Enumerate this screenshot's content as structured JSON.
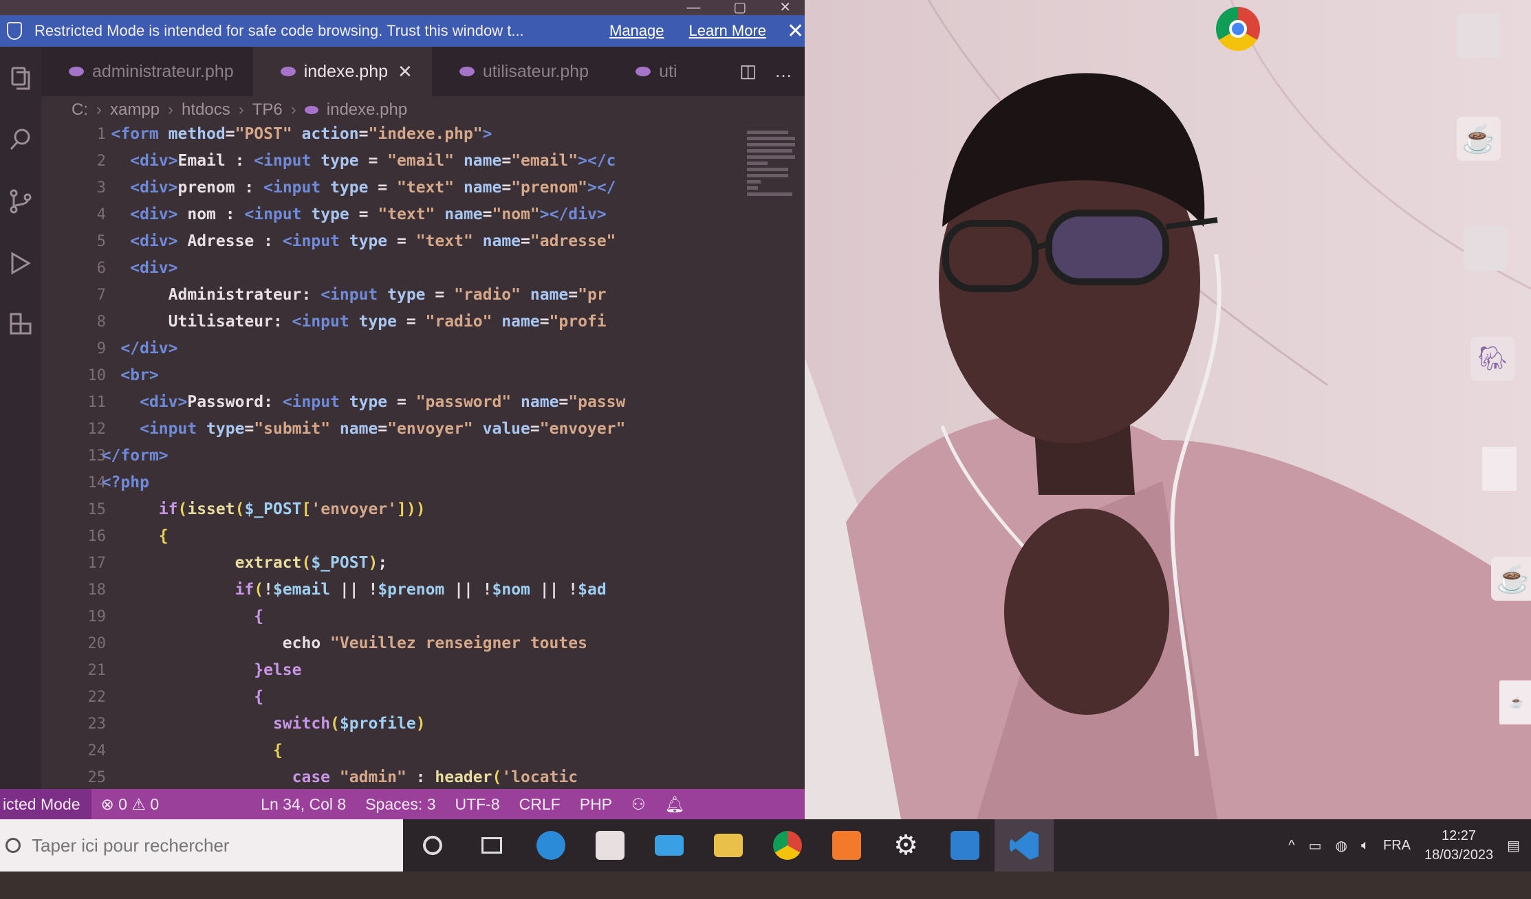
{
  "window": {
    "controls": [
      "—",
      "▢",
      "✕"
    ]
  },
  "banner": {
    "message": "Restricted Mode is intended for safe code browsing. Trust this window t...",
    "manage": "Manage",
    "learn_more": "Learn More",
    "close": "✕"
  },
  "tabs": [
    {
      "label": "administrateur.php",
      "active": false
    },
    {
      "label": "indexe.php",
      "active": true
    },
    {
      "label": "utilisateur.php",
      "active": false
    },
    {
      "label": "uti",
      "active": false
    }
  ],
  "tab_tools": {
    "split": "◫",
    "more": "…"
  },
  "breadcrumb": [
    "C:",
    "xampp",
    "htdocs",
    "TP6",
    "indexe.php"
  ],
  "editor": {
    "line_numbers": [
      "1",
      "2",
      "3",
      "4",
      "5",
      "6",
      "7",
      "8",
      "9",
      "10",
      "11",
      "12",
      "13",
      "14",
      "15",
      "16",
      "17",
      "18",
      "19",
      "20",
      "21",
      "22",
      "23",
      "24",
      "25"
    ]
  },
  "code": [
    {
      "i": "   ",
      "parts": [
        [
          "tag",
          "<form "
        ],
        [
          "attr",
          "method"
        ],
        [
          "txt",
          "="
        ],
        [
          "str",
          "\"POST\" "
        ],
        [
          "attr",
          "action"
        ],
        [
          "txt",
          "="
        ],
        [
          "str",
          "\"indexe.php\""
        ],
        [
          "tag",
          ">"
        ]
      ]
    },
    {
      "i": "     ",
      "parts": [
        [
          "tag",
          "<div>"
        ],
        [
          "txt",
          "Email : "
        ],
        [
          "tag",
          "<input "
        ],
        [
          "attr",
          "type"
        ],
        [
          "txt",
          " = "
        ],
        [
          "str",
          "\"email\" "
        ],
        [
          "attr",
          "name"
        ],
        [
          "txt",
          "="
        ],
        [
          "str",
          "\"email\""
        ],
        [
          "tag",
          "></c"
        ]
      ]
    },
    {
      "i": "     ",
      "parts": [
        [
          "tag",
          "<div>"
        ],
        [
          "txt",
          "prenom : "
        ],
        [
          "tag",
          "<input "
        ],
        [
          "attr",
          "type"
        ],
        [
          "txt",
          " = "
        ],
        [
          "str",
          "\"text\" "
        ],
        [
          "attr",
          "name"
        ],
        [
          "txt",
          "="
        ],
        [
          "str",
          "\"prenom\""
        ],
        [
          "tag",
          "></"
        ]
      ]
    },
    {
      "i": "     ",
      "parts": [
        [
          "tag",
          "<div> "
        ],
        [
          "txt",
          "nom : "
        ],
        [
          "tag",
          "<input "
        ],
        [
          "attr",
          "type"
        ],
        [
          "txt",
          " = "
        ],
        [
          "str",
          "\"text\" "
        ],
        [
          "attr",
          "name"
        ],
        [
          "txt",
          "="
        ],
        [
          "str",
          "\"nom\""
        ],
        [
          "tag",
          "></div>"
        ]
      ]
    },
    {
      "i": "     ",
      "parts": [
        [
          "tag",
          "<div> "
        ],
        [
          "txt",
          "Adresse : "
        ],
        [
          "tag",
          "<input "
        ],
        [
          "attr",
          "type"
        ],
        [
          "txt",
          " = "
        ],
        [
          "str",
          "\"text\" "
        ],
        [
          "attr",
          "name"
        ],
        [
          "txt",
          "="
        ],
        [
          "str",
          "\"adresse\""
        ]
      ]
    },
    {
      "i": "     ",
      "parts": [
        [
          "tag",
          "<div>"
        ]
      ]
    },
    {
      "i": "         ",
      "parts": [
        [
          "txt",
          "Administrateur: "
        ],
        [
          "tag",
          "<input "
        ],
        [
          "attr",
          "type"
        ],
        [
          "txt",
          " = "
        ],
        [
          "str",
          "\"radio\" "
        ],
        [
          "attr",
          "name"
        ],
        [
          "txt",
          "="
        ],
        [
          "str",
          "\"pr"
        ]
      ]
    },
    {
      "i": "         ",
      "parts": [
        [
          "txt",
          "Utilisateur: "
        ],
        [
          "tag",
          "<input "
        ],
        [
          "attr",
          "type"
        ],
        [
          "txt",
          " = "
        ],
        [
          "str",
          "\"radio\" "
        ],
        [
          "attr",
          "name"
        ],
        [
          "txt",
          "="
        ],
        [
          "str",
          "\"profi"
        ]
      ]
    },
    {
      "i": "    ",
      "parts": [
        [
          "tag",
          "</div>"
        ]
      ]
    },
    {
      "i": "    ",
      "parts": [
        [
          "tag",
          "<br>"
        ]
      ]
    },
    {
      "i": "      ",
      "parts": [
        [
          "tag",
          "<div>"
        ],
        [
          "txt",
          "Password: "
        ],
        [
          "tag",
          "<input "
        ],
        [
          "attr",
          "type"
        ],
        [
          "txt",
          " = "
        ],
        [
          "str",
          "\"password\" "
        ],
        [
          "attr",
          "name"
        ],
        [
          "txt",
          "="
        ],
        [
          "str",
          "\"passw"
        ]
      ]
    },
    {
      "i": "      ",
      "parts": [
        [
          "tag",
          "<input "
        ],
        [
          "attr",
          "type"
        ],
        [
          "txt",
          "="
        ],
        [
          "str",
          "\"submit\" "
        ],
        [
          "attr",
          "name"
        ],
        [
          "txt",
          "="
        ],
        [
          "str",
          "\"envoyer\" "
        ],
        [
          "attr",
          "value"
        ],
        [
          "txt",
          "="
        ],
        [
          "str",
          "\"envoyer\""
        ]
      ]
    },
    {
      "i": "  ",
      "parts": [
        [
          "tag",
          "</form>"
        ]
      ]
    },
    {
      "i": "  ",
      "parts": [
        [
          "tag",
          "<?php"
        ]
      ]
    },
    {
      "i": "        ",
      "parts": [
        [
          "kw",
          "if"
        ],
        [
          "brk",
          "("
        ],
        [
          "fn",
          "isset"
        ],
        [
          "brk",
          "("
        ],
        [
          "var",
          "$_POST"
        ],
        [
          "brk",
          "["
        ],
        [
          "str",
          "'envoyer'"
        ],
        [
          "brk",
          "]))"
        ]
      ]
    },
    {
      "i": "        ",
      "parts": [
        [
          "brk",
          "{"
        ]
      ]
    },
    {
      "i": "                ",
      "parts": [
        [
          "fn",
          "extract"
        ],
        [
          "brk",
          "("
        ],
        [
          "var",
          "$_POST"
        ],
        [
          "brk",
          ")"
        ],
        [
          "txt",
          ";"
        ]
      ]
    },
    {
      "i": "                ",
      "parts": [
        [
          "kw",
          "if"
        ],
        [
          "brk",
          "("
        ],
        [
          "txt",
          "!"
        ],
        [
          "var",
          "$email"
        ],
        [
          "txt",
          " || !"
        ],
        [
          "var",
          "$prenom"
        ],
        [
          "txt",
          " || !"
        ],
        [
          "var",
          "$nom"
        ],
        [
          "txt",
          " || !"
        ],
        [
          "var",
          "$ad"
        ]
      ]
    },
    {
      "i": "                  ",
      "parts": [
        [
          "kw",
          "{"
        ]
      ]
    },
    {
      "i": "                     ",
      "parts": [
        [
          "txt",
          "echo "
        ],
        [
          "str",
          "\"Veuillez renseigner toutes"
        ]
      ]
    },
    {
      "i": "                  ",
      "parts": [
        [
          "kw",
          "}else"
        ]
      ]
    },
    {
      "i": "                  ",
      "parts": [
        [
          "kw",
          "{"
        ]
      ]
    },
    {
      "i": "                    ",
      "parts": [
        [
          "kw",
          "switch"
        ],
        [
          "brk",
          "("
        ],
        [
          "var",
          "$profile"
        ],
        [
          "brk",
          ")"
        ]
      ]
    },
    {
      "i": "                    ",
      "parts": [
        [
          "brk",
          "{"
        ]
      ]
    },
    {
      "i": "                      ",
      "parts": [
        [
          "kw",
          "case "
        ],
        [
          "str",
          "\"admin\""
        ],
        [
          "txt",
          " : "
        ],
        [
          "fn",
          "header"
        ],
        [
          "brk",
          "("
        ],
        [
          "str",
          "'locatic"
        ]
      ]
    }
  ],
  "statusbar": {
    "mode": "icted Mode",
    "problems": "⊗ 0 ⚠ 0",
    "position": "Ln 34, Col 8",
    "spaces": "Spaces: 3",
    "encoding": "UTF-8",
    "eol": "CRLF",
    "language": "PHP"
  },
  "taskbar": {
    "search_placeholder": "Taper ici pour rechercher",
    "lang": "FRA",
    "time": "12:27",
    "date": "18/03/2023"
  },
  "colors": {
    "banner": "#3d5bb0",
    "statusbar": "#9a3f9a",
    "editor_bg": "#3b3036"
  }
}
